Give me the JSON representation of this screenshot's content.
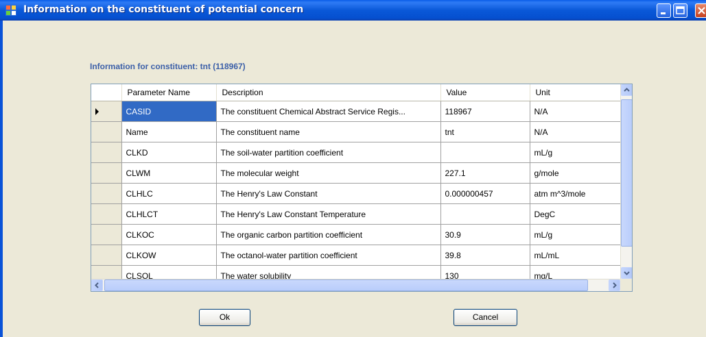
{
  "window": {
    "title": "Information on the constituent of potential concern"
  },
  "info_label": "Information for constituent: tnt (118967)",
  "grid": {
    "columns": [
      "Parameter Name",
      "Description",
      "Value",
      "Unit"
    ],
    "rows": [
      {
        "name": "CASID",
        "description": "The constituent Chemical Abstract Service Regis...",
        "value": "118967",
        "unit": "N/A"
      },
      {
        "name": "Name",
        "description": "The constituent name",
        "value": "tnt",
        "unit": "N/A"
      },
      {
        "name": "CLKD",
        "description": "The soil-water partition coefficient",
        "value": "",
        "unit": "mL/g"
      },
      {
        "name": "CLWM",
        "description": "The molecular weight",
        "value": "227.1",
        "unit": "g/mole"
      },
      {
        "name": "CLHLC",
        "description": "The Henry's Law Constant",
        "value": "0.000000457",
        "unit": "atm m^3/mole"
      },
      {
        "name": "CLHLCT",
        "description": "The Henry's Law Constant Temperature",
        "value": "",
        "unit": "DegC"
      },
      {
        "name": "CLKOC",
        "description": "The organic carbon partition coefficient",
        "value": "30.9",
        "unit": "mL/g"
      },
      {
        "name": "CLKOW",
        "description": "The octanol-water partition coefficient",
        "value": "39.8",
        "unit": "mL/mL"
      },
      {
        "name": "CLSOL",
        "description": "The water solubility",
        "value": "130",
        "unit": "mg/L"
      }
    ]
  },
  "buttons": {
    "ok": "Ok",
    "cancel": "Cancel"
  },
  "colors": {
    "titlebar": "#0a58d8",
    "selection": "#316ac5",
    "dialog_bg": "#ece9d8",
    "label": "#3b5fa8"
  }
}
